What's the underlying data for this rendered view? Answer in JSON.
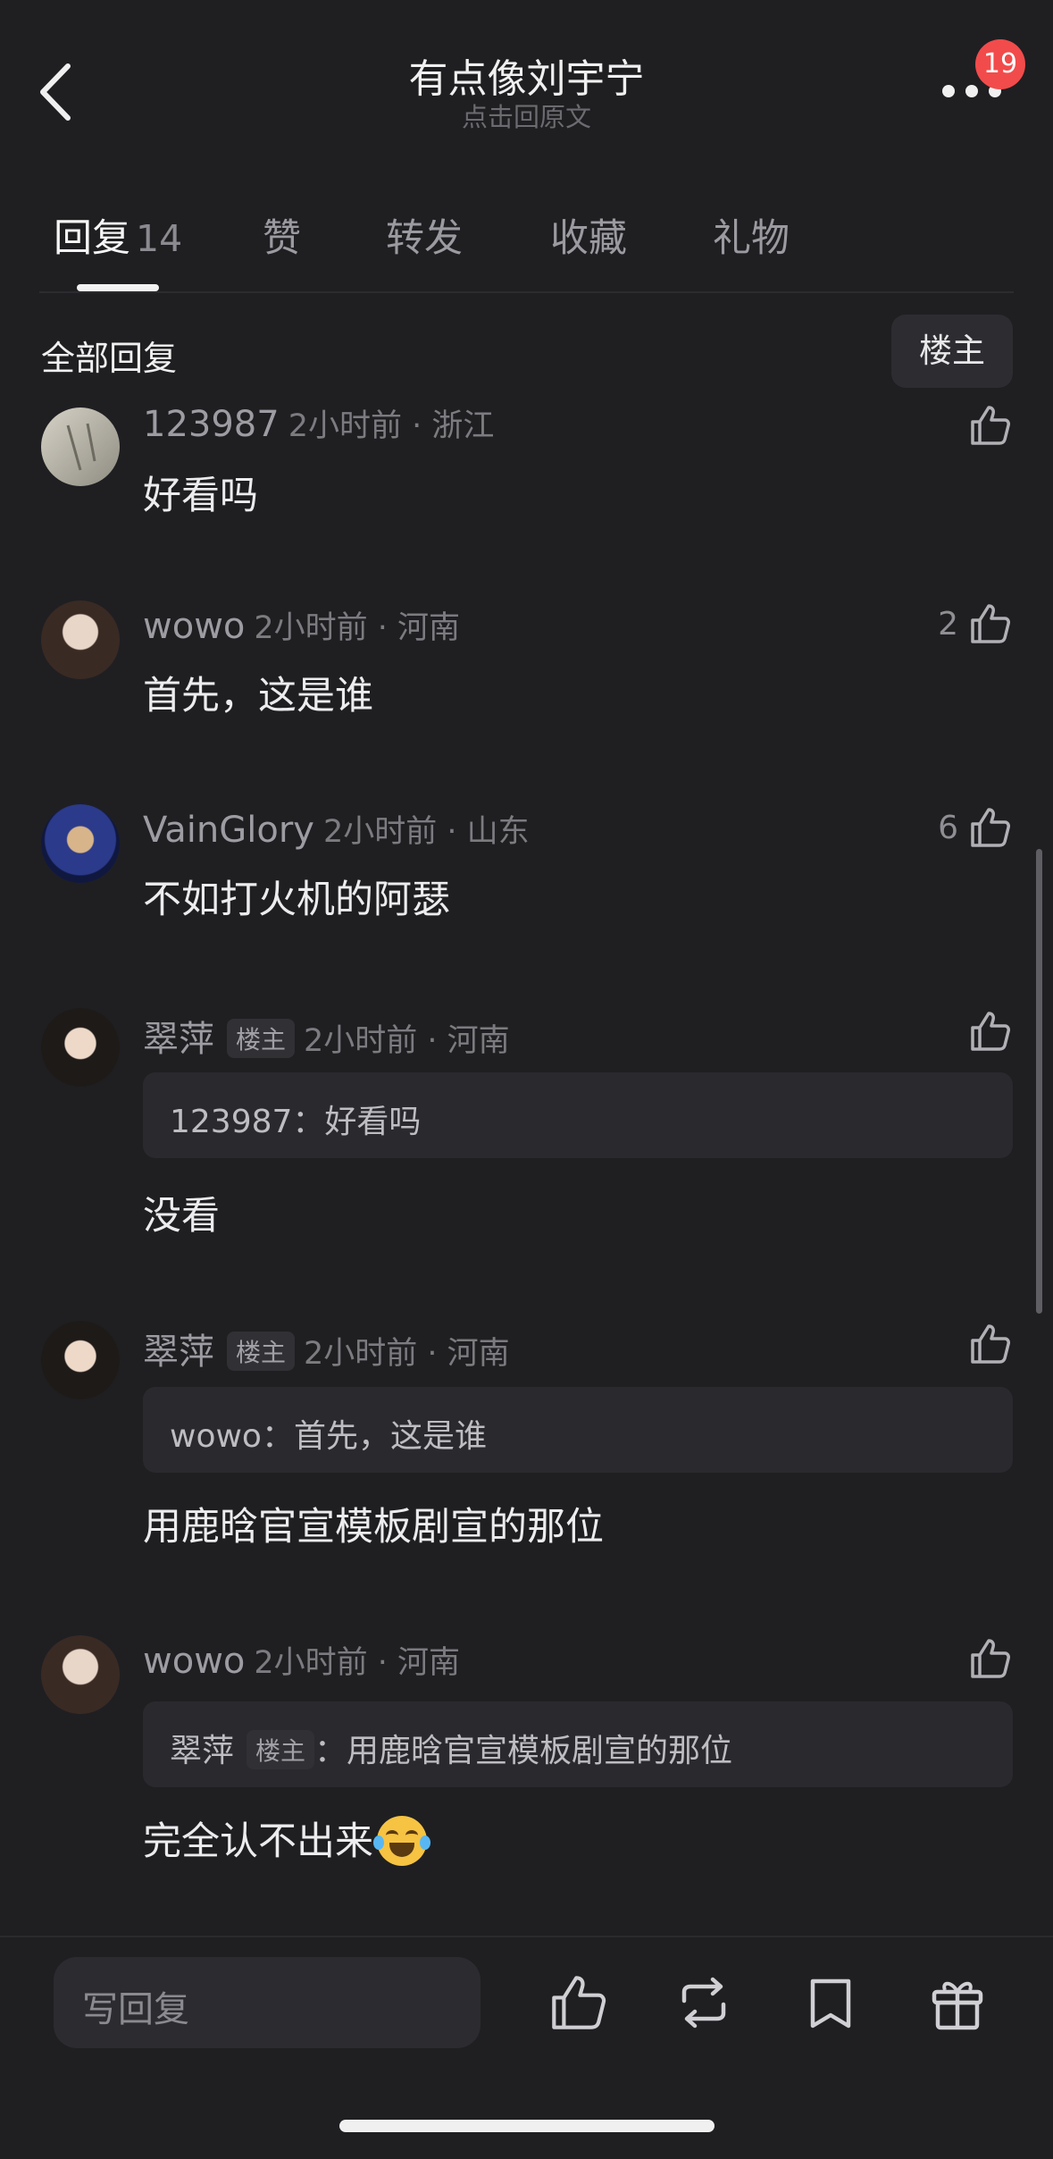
{
  "header": {
    "title": "有点像刘宇宁",
    "subtitle": "点击回原文",
    "notification_count": "19"
  },
  "tabs": [
    {
      "label": "回复",
      "count": "14",
      "active": true
    },
    {
      "label": "赞"
    },
    {
      "label": "转发"
    },
    {
      "label": "收藏"
    },
    {
      "label": "礼物"
    }
  ],
  "section": {
    "title": "全部回复",
    "filter_label": "楼主"
  },
  "comments": [
    {
      "name": "123987",
      "time": "2小时前 · 浙江",
      "text": "好看吗",
      "likes": ""
    },
    {
      "name": "wowo",
      "time": "2小时前 · 河南",
      "text": "首先，这是谁",
      "likes": "2"
    },
    {
      "name": "VainGlory",
      "time": "2小时前 · 山东",
      "text": "不如打火机的阿瑟",
      "likes": "6"
    },
    {
      "name": "翠萍",
      "tag": "楼主",
      "time": "2小时前 · 河南",
      "quote": "123987：好看吗",
      "text": "没看",
      "likes": ""
    },
    {
      "name": "翠萍",
      "tag": "楼主",
      "time": "2小时前 · 河南",
      "quote": "wowo：首先，这是谁",
      "text": "用鹿晗官宣模板剧宣的那位",
      "likes": ""
    },
    {
      "name": "wowo",
      "time": "2小时前 · 河南",
      "quote_name": "翠萍",
      "quote_tag": "楼主",
      "quote_text": "：用鹿晗官宣模板剧宣的那位",
      "text": "完全认不出来",
      "likes": ""
    }
  ],
  "bottom_bar": {
    "reply_placeholder": "写回复",
    "icons": [
      "like-icon",
      "repost-icon",
      "bookmark-icon",
      "gift-icon"
    ]
  },
  "colors": {
    "background": "#1f1f22",
    "badge": "#f24b4b",
    "text_primary": "#ececee",
    "text_secondary": "#8e8e93"
  }
}
